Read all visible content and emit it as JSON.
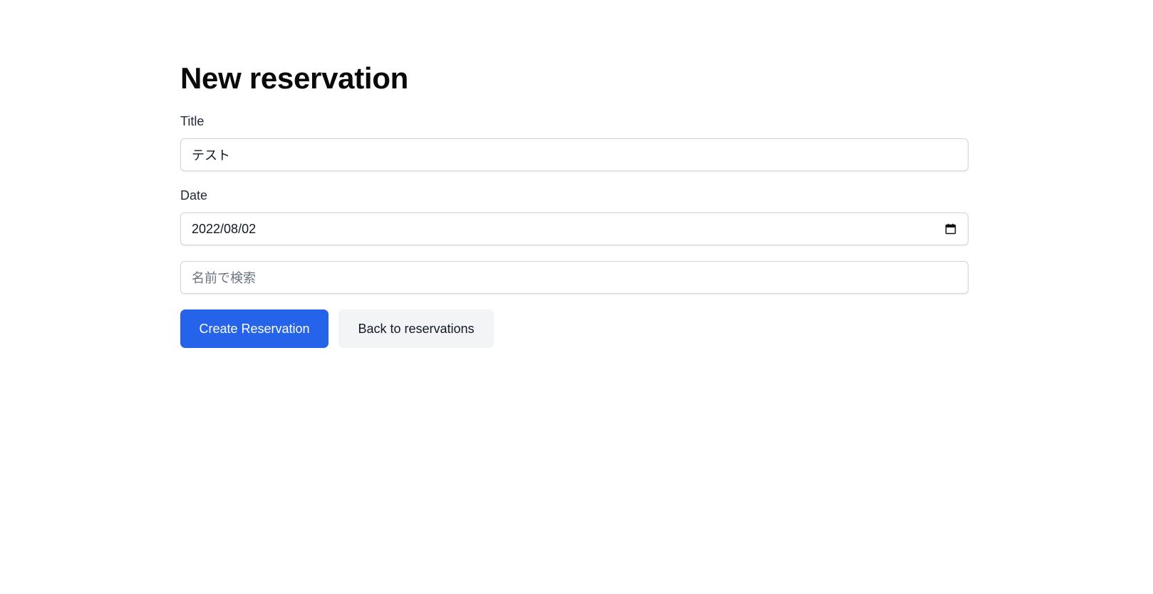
{
  "page": {
    "title": "New reservation"
  },
  "form": {
    "title_label": "Title",
    "title_value": "テスト",
    "date_label": "Date",
    "date_value": "2022/08/02",
    "search_placeholder": "名前で検索"
  },
  "actions": {
    "create_label": "Create Reservation",
    "back_label": "Back to reservations"
  },
  "colors": {
    "primary": "#2563eb",
    "secondary_bg": "#f3f4f6"
  },
  "icons": {
    "date": "calendar-icon"
  }
}
